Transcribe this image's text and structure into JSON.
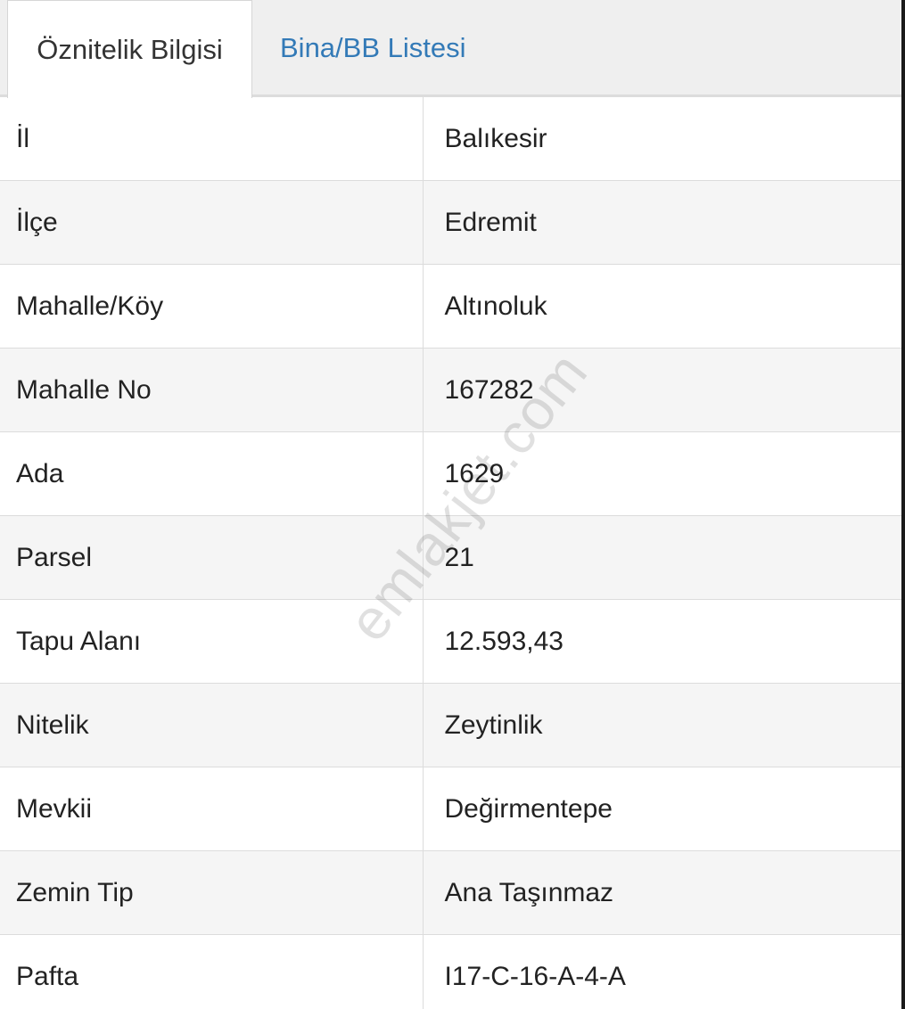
{
  "tabs": {
    "active_label": "Öznitelik Bilgisi",
    "inactive_label": "Bina/BB Listesi"
  },
  "rows": [
    {
      "label": "İl",
      "value": "Balıkesir"
    },
    {
      "label": "İlçe",
      "value": "Edremit"
    },
    {
      "label": "Mahalle/Köy",
      "value": "Altınoluk"
    },
    {
      "label": "Mahalle No",
      "value": "167282"
    },
    {
      "label": "Ada",
      "value": "1629"
    },
    {
      "label": "Parsel",
      "value": "21"
    },
    {
      "label": "Tapu Alanı",
      "value": "12.593,43"
    },
    {
      "label": "Nitelik",
      "value": "Zeytinlik"
    },
    {
      "label": "Mevkii",
      "value": "Değirmentepe"
    },
    {
      "label": "Zemin Tip",
      "value": "Ana Taşınmaz"
    },
    {
      "label": "Pafta",
      "value": "I17-C-16-A-4-A"
    }
  ],
  "watermark": "emlakjet.com",
  "colors": {
    "tab_link": "#337ab7",
    "row_alt": "#f5f5f5",
    "border": "#dcdcdc"
  }
}
